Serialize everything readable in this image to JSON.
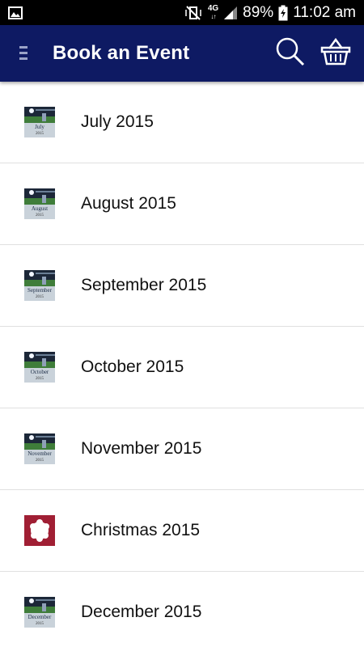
{
  "status_bar": {
    "network": "4G",
    "battery": "89%",
    "time": "11:02 am"
  },
  "app_bar": {
    "title": "Book an Event",
    "icons": {
      "menu": "menu-icon",
      "search": "search-icon",
      "basket": "basket-icon"
    },
    "background": "#0e1a63"
  },
  "events": [
    {
      "label": "July 2015",
      "thumb_caption": "July",
      "thumb_year": "2015",
      "thumb_type": "stadium"
    },
    {
      "label": "August 2015",
      "thumb_caption": "August",
      "thumb_year": "2015",
      "thumb_type": "stadium"
    },
    {
      "label": "September 2015",
      "thumb_caption": "September",
      "thumb_year": "2015",
      "thumb_type": "stadium"
    },
    {
      "label": "October 2015",
      "thumb_caption": "October",
      "thumb_year": "2015",
      "thumb_type": "stadium"
    },
    {
      "label": "November 2015",
      "thumb_caption": "November",
      "thumb_year": "2015",
      "thumb_type": "stadium"
    },
    {
      "label": "Christmas 2015",
      "thumb_caption": "",
      "thumb_year": "",
      "thumb_type": "christmas"
    },
    {
      "label": "December 2015",
      "thumb_caption": "December",
      "thumb_year": "2015",
      "thumb_type": "stadium"
    }
  ]
}
